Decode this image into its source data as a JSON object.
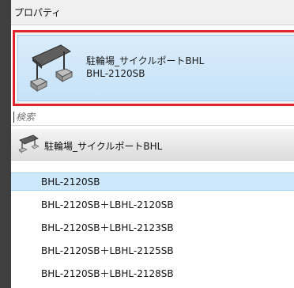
{
  "panel": {
    "title": "プロパティ"
  },
  "type_selector": {
    "family_name": "駐輪場_サイクルポートBHL",
    "type_name": "BHL-2120SB"
  },
  "search": {
    "placeholder": "検索",
    "value": ""
  },
  "family_group": {
    "label": "駐輪場_サイクルポートBHL"
  },
  "type_list": {
    "items": [
      {
        "label": "BHL-2120SB",
        "selected": true
      },
      {
        "label": "BHL-2120SB＋LBHL-2120SB",
        "selected": false
      },
      {
        "label": "BHL-2120SB＋LBHL-2123SB",
        "selected": false
      },
      {
        "label": "BHL-2120SB＋LBHL-2125SB",
        "selected": false
      },
      {
        "label": "BHL-2120SB＋LBHL-2128SB",
        "selected": false
      }
    ]
  },
  "colors": {
    "highlight_border": "#e0232c",
    "selection": "#cde8fb"
  }
}
